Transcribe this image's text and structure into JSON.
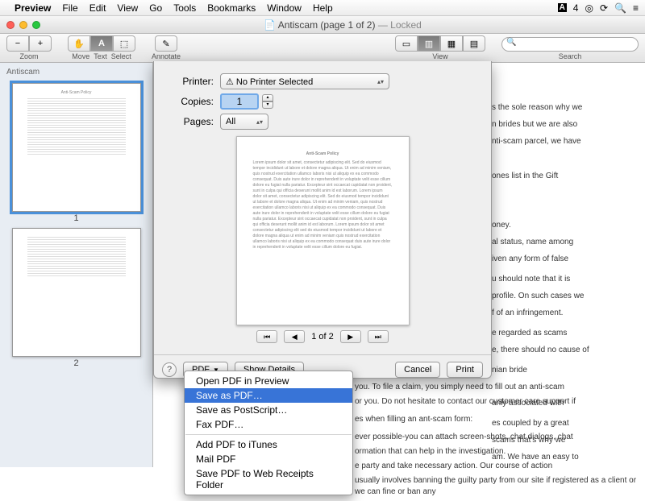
{
  "menubar": {
    "apple": "",
    "app": "Preview",
    "items": [
      "File",
      "Edit",
      "View",
      "Go",
      "Tools",
      "Bookmarks",
      "Window",
      "Help"
    ],
    "status_badge": "4"
  },
  "titlebar": {
    "doc_icon": "📄",
    "title": "Antiscam (page 1 of 2)",
    "locked": "— Locked"
  },
  "toolbar": {
    "zoom_label": "Zoom",
    "move_label": "Move",
    "text_label": "Text",
    "select_label": "Select",
    "annotate_label": "Annotate",
    "view_label": "View",
    "search_label": "Search",
    "search_placeholder": ""
  },
  "sidebar": {
    "title": "Antiscam",
    "thumbs": [
      {
        "num": "1"
      },
      {
        "num": "2"
      }
    ]
  },
  "print": {
    "printer_label": "Printer:",
    "printer_value": "⚠ No Printer Selected",
    "copies_label": "Copies:",
    "copies_value": "1",
    "pages_label": "Pages:",
    "pages_value": "All",
    "page_indicator": "1 of 2",
    "help": "?",
    "pdf_btn": "PDF",
    "show_details": "Show Details",
    "cancel": "Cancel",
    "print_btn": "Print"
  },
  "pdf_menu": {
    "items": [
      "Open PDF in Preview",
      "Save as PDF…",
      "Save as PostScript…",
      "Fax PDF…"
    ],
    "items2": [
      "Add PDF to iTunes",
      "Mail PDF",
      "Save PDF to Web Receipts Folder"
    ],
    "selected_index": 1
  },
  "bg": {
    "p1": "s the sole reason why we",
    "p2": "n brides but we are also",
    "p3": "nti-scam parcel, we have",
    "p4": "ones list in the Gift",
    "p5": "oney.",
    "p6": "al status, name among",
    "p7": "iven any form of false",
    "p8": "u should note that it is",
    "p9": "profile. On such cases we",
    "p10": "f of an infringement.",
    "p11": "e regarded as scams",
    "p12": "e, there should no cause of",
    "p13": "nian bride",
    "p14": "arily associated with",
    "p15": "es coupled by a great",
    "p16": "scams that's why we",
    "p17": "am. We have an easy to",
    "b1": "you. To file a claim, you simply need to fill out an anti-scam",
    "b2": "or you. Do not hesitate to contact our customer care support if",
    "b3": "es when filling an ant-scam form:",
    "b4": "ever possible-you can attach screen-shots, chat dialogs, chat",
    "b5": "ormation that can help in the investigation.",
    "b6": "e party and take necessary action. Our course of action",
    "b7": "usually involves banning the guilty party from our site if registered as a client or we can fine or ban any"
  }
}
